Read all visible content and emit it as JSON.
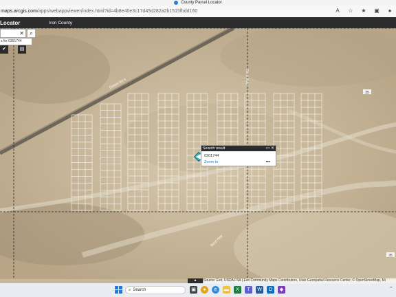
{
  "browser": {
    "tab_title": "County Parcel Locator",
    "url_host": "maps.arcgis.com",
    "url_path": "/apps/webappviewer/index.html?id=4b8e40e3c17d45d282a2b1515fbdd160",
    "icons": [
      "read-aloud-icon",
      "favorite-icon",
      "favorites-bar-icon",
      "collections-icon",
      "profile-icon"
    ]
  },
  "app": {
    "title": "Locator",
    "county": "Iron County"
  },
  "search": {
    "value": "",
    "clear": "✕",
    "button_icon": "search-icon",
    "hint": "s for 0301744"
  },
  "map": {
    "route_label_1": "35",
    "route_label_2": "35",
    "road_label_nw": "Dunes Rd 4",
    "road_label_mid": "Beryl Hwy",
    "road_label_s": "Beryl Hwy"
  },
  "popup": {
    "title": "Search result",
    "parcel": "0301744",
    "zoom_to": "Zoom to",
    "more": "•••",
    "min": "▭",
    "close": "✕"
  },
  "attribution": {
    "collapse": "▲",
    "text": "Source: Esri, USDA FSA | Esri Community Maps Contributors, Utah Geospatial Resource Center, © OpenStreetMap, Mi"
  },
  "taskbar": {
    "search_placeholder": "Search"
  },
  "colors": {
    "header_bg": "#2c2c2c",
    "terrain": "#c8b79b",
    "parcel_lines": "#f2efe6",
    "accent": "#2a6fb5"
  }
}
